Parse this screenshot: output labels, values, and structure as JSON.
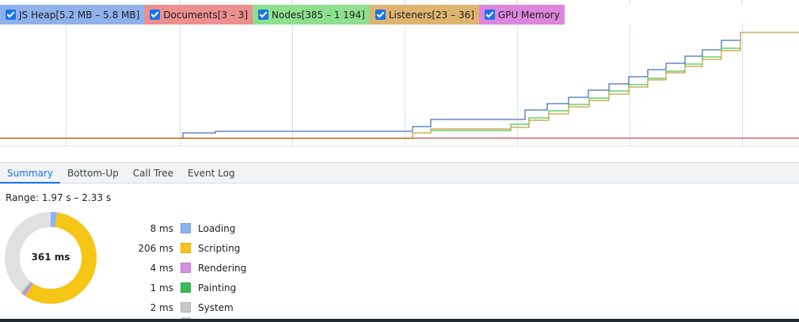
{
  "counters": [
    {
      "id": "js-heap",
      "label": "JS Heap[5.2 MB – 5.8 MB]",
      "color": "#8fb1ec",
      "checked": true
    },
    {
      "id": "documents",
      "label": "Documents[3 – 3]",
      "color": "#ec8f8f",
      "checked": true
    },
    {
      "id": "nodes",
      "label": "Nodes[385 – 1 194]",
      "color": "#8ee08e",
      "checked": true
    },
    {
      "id": "listeners",
      "label": "Listeners[23 – 36]",
      "color": "#dfb471",
      "checked": true
    },
    {
      "id": "gpu-memory",
      "label": "GPU Memory",
      "color": "#dc86de",
      "checked": true
    }
  ],
  "line_colors": {
    "js_heap": "#1a4ba8",
    "documents": "#c62828",
    "nodes": "#1fb91f",
    "listeners": "#b8860b"
  },
  "tabs": [
    {
      "id": "summary",
      "label": "Summary",
      "active": true
    },
    {
      "id": "bottom-up",
      "label": "Bottom-Up",
      "active": false
    },
    {
      "id": "call-tree",
      "label": "Call Tree",
      "active": false
    },
    {
      "id": "event-log",
      "label": "Event Log",
      "active": false
    }
  ],
  "summary": {
    "range": "Range: 1.97 s – 2.33 s",
    "total": "361 ms",
    "total_ms": 361,
    "categories": [
      {
        "name": "Loading",
        "time": "8 ms",
        "ms": 8,
        "color": "#8cb1f0"
      },
      {
        "name": "Scripting",
        "time": "206 ms",
        "ms": 206,
        "color": "#f6c617"
      },
      {
        "name": "Rendering",
        "time": "4 ms",
        "ms": 4,
        "color": "#d68ce8"
      },
      {
        "name": "Painting",
        "time": "1 ms",
        "ms": 1,
        "color": "#3aba5a"
      },
      {
        "name": "System",
        "time": "2 ms",
        "ms": 2,
        "color": "#c8c8c8"
      }
    ],
    "idle_color": "#e0e0e0"
  }
}
